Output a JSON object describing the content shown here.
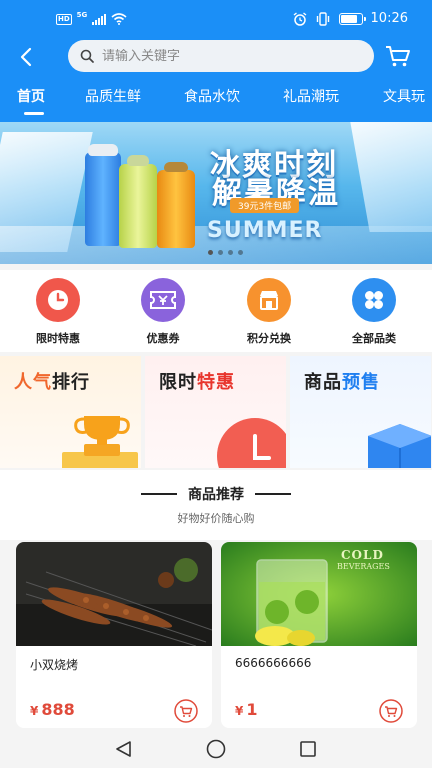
{
  "status_bar": {
    "network": "HD",
    "signal_label": "5G",
    "time": "10:26"
  },
  "search": {
    "placeholder": "请输入关键字"
  },
  "tabs": [
    {
      "label": "首页"
    },
    {
      "label": "品质生鲜"
    },
    {
      "label": "食品水饮"
    },
    {
      "label": "礼品潮玩"
    },
    {
      "label": "文具玩"
    }
  ],
  "banner": {
    "title_line1": "冰爽时刻",
    "title_line2": "解暑降温",
    "tag": "39元3件包邮",
    "caption": "SUMMER",
    "page_indicator": {
      "count": 4,
      "active": 0
    }
  },
  "quick_entries": [
    {
      "label": "限时特惠",
      "icon": "clock-icon",
      "color": "#f0574b"
    },
    {
      "label": "优惠券",
      "icon": "coupon-icon",
      "color": "#8a63dc"
    },
    {
      "label": "积分兑换",
      "icon": "store-icon",
      "color": "#f7922e"
    },
    {
      "label": "全部品类",
      "icon": "grid-icon",
      "color": "#2e8ff0"
    }
  ],
  "promos": [
    {
      "part1": "人气",
      "part2": "排行",
      "color1": "#f0672d",
      "color2": "#222222"
    },
    {
      "part1": "限时",
      "part2": "特惠",
      "color1": "#222222",
      "color2": "#e8352d"
    },
    {
      "part1": "商品",
      "part2": "预售",
      "color1": "#222222",
      "color2": "#1f7ff0"
    }
  ],
  "recommend": {
    "title": "商品推荐",
    "subtitle": "好物好价随心购"
  },
  "products": [
    {
      "name": "小双烧烤",
      "currency": "¥",
      "price": "888"
    },
    {
      "name": "6666666666",
      "currency": "¥",
      "price": "1",
      "image_text_1": "COLD",
      "image_text_2": "BEVERAGES"
    }
  ],
  "colors": {
    "primary": "#1b8ff7",
    "price": "#e04a3a"
  }
}
